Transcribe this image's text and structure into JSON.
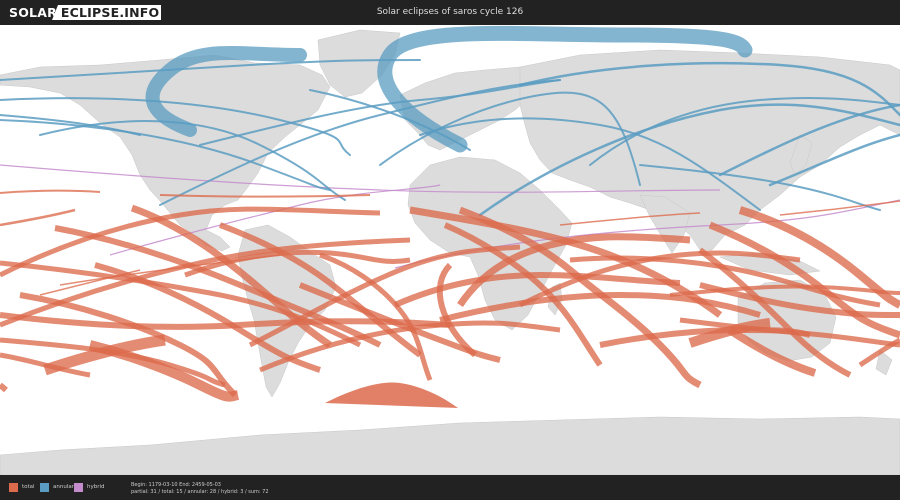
{
  "header": {
    "logo_part1": "SOLAR",
    "logo_part2": "ECLIPSE.INFO",
    "title": "Solar eclipses of saros cycle 126"
  },
  "colors": {
    "bar": "#222222",
    "land": "#dcdcdc",
    "total": "#dc6a4c",
    "annular": "#5a9cc2",
    "hybrid": "#c48ccc"
  },
  "legend": {
    "total_label": "total",
    "annular_label": "annular",
    "hybrid_label": "hybrid"
  },
  "footer": {
    "line1": "Begin: 1179-03-10 End: 2459-05-03",
    "line2": "partial: 31 / total: 15 / annular: 28 / hybrid: 3 / sum: 72"
  }
}
